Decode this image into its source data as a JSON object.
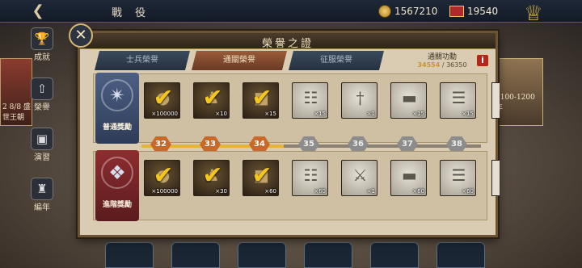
{
  "topbar": {
    "back_icon": "back-arrow-icon",
    "title": "戰 役",
    "gold": "1567210",
    "gems": "19540"
  },
  "side_menu": [
    {
      "icon": "trophy-icon",
      "label": "成就"
    },
    {
      "icon": "upload-icon",
      "label": "榮譽"
    },
    {
      "icon": "film-icon",
      "label": "演習"
    },
    {
      "icon": "helmet-icon",
      "label": "編年"
    }
  ],
  "left_card": {
    "label": "2 8/8 盛世王朝"
  },
  "right_card": {
    "label": "1100-1200年"
  },
  "dialog": {
    "title": "榮譽之證",
    "close_icon": "close-icon",
    "tabs": [
      "士兵榮譽",
      "通關榮譽",
      "征服榮譽"
    ],
    "active_tab": 1,
    "merit": {
      "label": "通關功勳",
      "current": "34554",
      "total": "36350"
    },
    "info_label": "i",
    "rows": [
      {
        "name": "普通獎勵",
        "medal_color": "blue",
        "items": [
          {
            "icon": "coin-sack-icon",
            "qty": "×100000",
            "claimed": true,
            "style": "dark"
          },
          {
            "icon": "archer-soldier-icon",
            "qty": "×10",
            "claimed": true,
            "style": "dark"
          },
          {
            "icon": "leather-bag-icon",
            "qty": "×15",
            "claimed": true,
            "style": "dark"
          },
          {
            "icon": "scroll-map-icon",
            "qty": "×15",
            "claimed": false,
            "style": "light"
          },
          {
            "icon": "sword-icon",
            "qty": "×1",
            "claimed": false,
            "style": "light"
          },
          {
            "icon": "ingot-icon",
            "qty": "×15",
            "claimed": false,
            "style": "light"
          },
          {
            "icon": "document-icon",
            "qty": "×15",
            "claimed": false,
            "style": "light"
          }
        ]
      },
      {
        "name": "進階獎勵",
        "medal_color": "red",
        "items": [
          {
            "icon": "coin-sack-icon",
            "qty": "×100000",
            "claimed": true,
            "style": "dark"
          },
          {
            "icon": "archer-soldier-icon",
            "qty": "×30",
            "claimed": true,
            "style": "dark"
          },
          {
            "icon": "leather-bag-icon",
            "qty": "×60",
            "claimed": true,
            "style": "dark"
          },
          {
            "icon": "scroll-map-icon",
            "qty": "×60",
            "claimed": false,
            "style": "light"
          },
          {
            "icon": "crossed-swords-icon",
            "qty": "×1",
            "claimed": false,
            "style": "light"
          },
          {
            "icon": "ingot-icon",
            "qty": "×60",
            "claimed": false,
            "style": "light"
          },
          {
            "icon": "document-icon",
            "qty": "×60",
            "claimed": false,
            "style": "light"
          }
        ]
      }
    ],
    "levels": [
      {
        "n": "32",
        "reached": true
      },
      {
        "n": "33",
        "reached": true
      },
      {
        "n": "34",
        "reached": true
      },
      {
        "n": "35",
        "reached": false
      },
      {
        "n": "36",
        "reached": false
      },
      {
        "n": "37",
        "reached": false
      },
      {
        "n": "38",
        "reached": false
      }
    ]
  }
}
